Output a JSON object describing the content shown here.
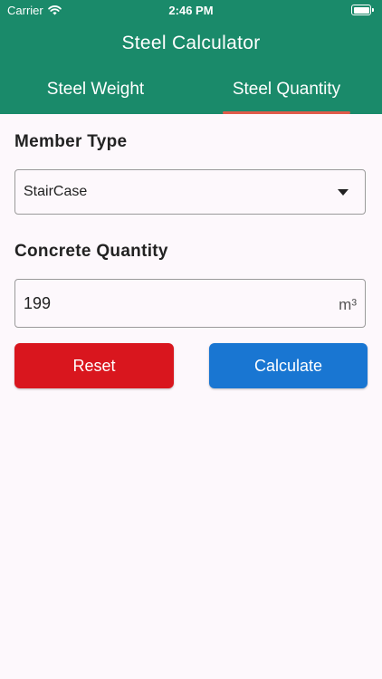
{
  "status_bar": {
    "carrier": "Carrier",
    "time": "2:46 PM"
  },
  "app": {
    "title": "Steel Calculator"
  },
  "tabs": [
    {
      "label": "Steel Weight",
      "selected": false
    },
    {
      "label": "Steel Quantity",
      "selected": true
    }
  ],
  "form": {
    "member_type": {
      "label": "Member Type",
      "value": "StairCase"
    },
    "concrete_quantity": {
      "label": "Concrete Quantity",
      "value": "199",
      "unit": "m³"
    }
  },
  "buttons": {
    "reset": "Reset",
    "calculate": "Calculate"
  },
  "colors": {
    "header": "#1a8a6a",
    "tab_indicator": "#e05a4a",
    "reset": "#d9161e",
    "calculate": "#1976d2",
    "background": "#fdf8fc"
  },
  "icons": {
    "wifi": "wifi-icon",
    "battery": "battery-icon",
    "dropdown": "chevron-down-icon"
  }
}
